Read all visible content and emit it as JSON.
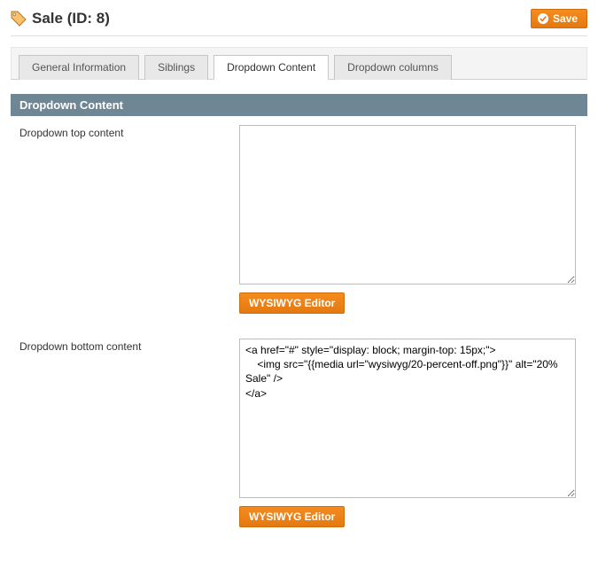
{
  "header": {
    "title": "Sale (ID: 8)",
    "save_label": "Save"
  },
  "tabs": {
    "t0": "General Information",
    "t1": "Siblings",
    "t2": "Dropdown Content",
    "t3": "Dropdown columns",
    "active_index": 2
  },
  "panel": {
    "title": "Dropdown Content",
    "fields": {
      "top": {
        "label": "Dropdown top content",
        "value": "",
        "editor_btn": "WYSIWYG Editor"
      },
      "bottom": {
        "label": "Dropdown bottom content",
        "value": "<a href=\"#\" style=\"display: block; margin-top: 15px;\">\n    <img src=\"{{media url=\"wysiwyg/20-percent-off.png\"}}\" alt=\"20% Sale\" />\n</a>",
        "editor_btn": "WYSIWYG Editor"
      }
    }
  }
}
